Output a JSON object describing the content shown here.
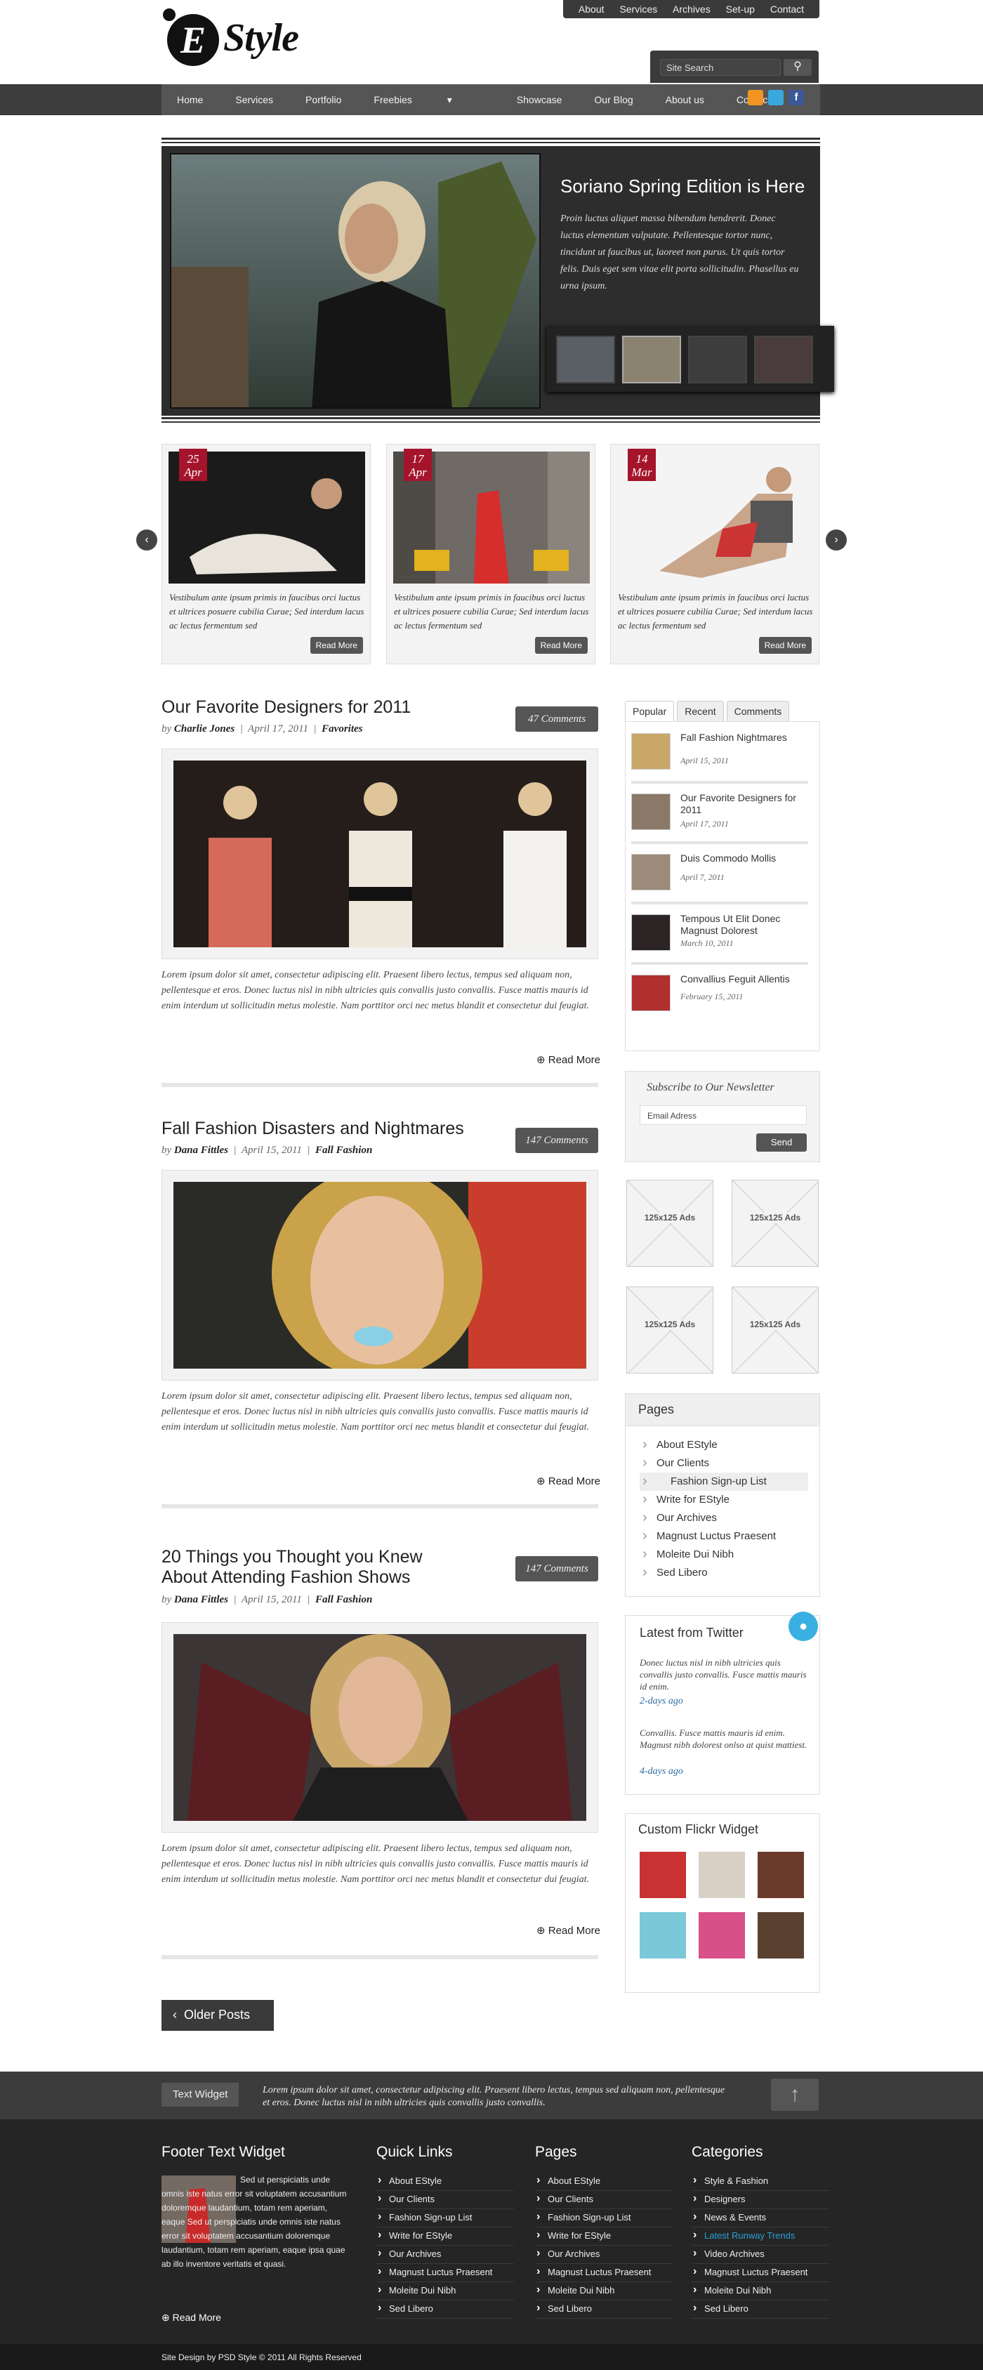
{
  "top_nav": [
    "About",
    "Services",
    "Archives",
    "Set-up",
    "Contact"
  ],
  "logo": {
    "mark": "E",
    "text": "Style"
  },
  "search": {
    "placeholder": "Site Search",
    "icon": "magnifier-icon"
  },
  "main_nav": [
    "Home",
    "Services",
    "Portfolio",
    "Freebies",
    "Showcase",
    "Our Blog",
    "About us",
    "Contact"
  ],
  "social_icons": [
    "rss-icon",
    "twitter-icon",
    "facebook-icon"
  ],
  "colors": {
    "accent_red": "#a4142b",
    "dark": "#2d2d2d",
    "link_blue": "#2a6aa0"
  },
  "slider": {
    "title": "Soriano Spring Edition is Here",
    "text": "Proin luctus aliquet massa bibendum hendrerit. Donec luctus elementum vulputate. Pellentesque tortor nunc, tincidunt ut faucibus ut, laoreet non purus. Ut quis tortor felis. Duis eget sem vitae elit porta sollicitudin. Phasellus eu urna ipsum."
  },
  "carousel": [
    {
      "day": "25",
      "month": "Apr",
      "text": "Vestibulum ante ipsum primis in faucibus orci luctus et ultrices posuere cubilia Curae; Sed interdum lacus ac lectus fermentum sed",
      "button": "Read More"
    },
    {
      "day": "17",
      "month": "Apr",
      "text": "Vestibulum ante ipsum primis in faucibus orci luctus et ultrices posuere cubilia Curae; Sed interdum lacus ac lectus fermentum sed",
      "button": "Read More"
    },
    {
      "day": "14",
      "month": "Mar",
      "text": "Vestibulum ante ipsum primis in faucibus orci luctus et ultrices posuere cubilia Curae; Sed interdum lacus ac lectus fermentum sed",
      "button": "Read More"
    }
  ],
  "posts": [
    {
      "title": "Our Favorite Designers for 2011",
      "by": "by",
      "author": "Charlie Jones",
      "date": "April 17, 2011",
      "category": "Favorites",
      "comments": "47 Comments",
      "excerpt": "Lorem ipsum dolor sit amet, consectetur adipiscing elit. Praesent libero lectus, tempus sed aliquam non, pellentesque et eros. Donec luctus nisl in nibh ultricies quis convallis justo convallis. Fusce mattis mauris id enim interdum ut sollicitudin metus molestie. Nam porttitor orci nec metus blandit et consectetur dui feugiat.",
      "more": "Read More"
    },
    {
      "title": "Fall Fashion Disasters and Nightmares",
      "by": "by",
      "author": "Dana Fittles",
      "date": "April 15, 2011",
      "category": "Fall Fashion",
      "comments": "147 Comments",
      "excerpt": "Lorem ipsum dolor sit amet, consectetur adipiscing elit. Praesent libero lectus, tempus sed aliquam non, pellentesque et eros. Donec luctus nisl in nibh ultricies quis convallis justo convallis. Fusce mattis mauris id enim interdum ut sollicitudin metus molestie. Nam porttitor orci nec metus blandit et consectetur dui feugiat.",
      "more": "Read More"
    },
    {
      "title": "20 Things you Thought you Knew About Attending Fashion Shows",
      "by": "by",
      "author": "Dana Fittles",
      "date": "April 15, 2011",
      "category": "Fall Fashion",
      "comments": "147 Comments",
      "excerpt": "Lorem ipsum dolor sit amet, consectetur adipiscing elit. Praesent libero lectus, tempus sed aliquam non, pellentesque et eros. Donec luctus nisl in nibh ultricies quis convallis justo convallis. Fusce mattis mauris id enim interdum ut sollicitudin metus molestie. Nam porttitor orci nec metus blandit et consectetur dui feugiat.",
      "more": "Read More"
    }
  ],
  "older_posts": "Older Posts",
  "sidebar": {
    "tabs": [
      "Popular",
      "Recent",
      "Comments"
    ],
    "popular": [
      {
        "title": "Fall Fashion Nightmares",
        "date": "April 15, 2011"
      },
      {
        "title": "Our Favorite Designers for 2011",
        "date": "April 17, 2011"
      },
      {
        "title": "Duis Commodo Mollis",
        "date": "April 7, 2011"
      },
      {
        "title": "Tempous Ut Elit Donec Magnust Dolorest",
        "date": "March 10, 2011"
      },
      {
        "title": "Convallius Feguit Allentis",
        "date": "February 15, 2011"
      }
    ],
    "newsletter": {
      "title": "Subscribe to Our Newsletter",
      "placeholder": "Email Adress",
      "button": "Send"
    },
    "ads": [
      "125x125 Ads",
      "125x125 Ads",
      "125x125 Ads",
      "125x125 Ads"
    ],
    "pages": {
      "title": "Pages",
      "items": [
        "About EStyle",
        "Our Clients",
        "Fashion Sign-up List",
        "Write for EStyle",
        "Our Archives",
        "Magnust Luctus Praesent",
        "Moleite Dui Nibh",
        "Sed Libero"
      ]
    },
    "twitter": {
      "title": "Latest from Twitter",
      "tweets": [
        {
          "text": "Donec luctus nisl in nibh ultricies quis convallis justo convallis. Fusce mattis mauris id enim.",
          "time": "2-days ago"
        },
        {
          "text": "Convallis. Fusce mattis mauris id enim. Magnust nibh dolorest onlso at quist mattiest.",
          "time": "4-days ago"
        }
      ]
    },
    "flickr": {
      "title": "Custom Flickr Widget"
    }
  },
  "footer": {
    "text_widget_label": "Text Widget",
    "text_widget_body": "Lorem ipsum dolor sit amet, consectetur adipiscing elit. Praesent libero lectus, tempus sed aliquam non, pellentesque et eros. Donec luctus nisl in nibh ultricies quis convallis justo convallis.",
    "col1": {
      "title": "Footer Text Widget",
      "text": "Sed ut perspiciatis unde omnis iste natus error sit voluptatem accusantium doloremque laudantium, totam rem aperiam, eaque Sed ut perspiciatis unde omnis iste natus error sit voluptatem accusantium doloremque laudantium, totam rem aperiam, eaque ipsa quae ab illo inventore veritatis et quasi.",
      "more": "Read More"
    },
    "col2": {
      "title": "Quick Links",
      "items": [
        "About EStyle",
        "Our Clients",
        "Fashion Sign-up List",
        "Write for EStyle",
        "Our Archives",
        "Magnust Luctus Praesent",
        "Moleite Dui Nibh",
        "Sed Libero"
      ]
    },
    "col3": {
      "title": "Pages",
      "items": [
        "About EStyle",
        "Our Clients",
        "Fashion Sign-up List",
        "Write for EStyle",
        "Our Archives",
        "Magnust Luctus Praesent",
        "Moleite Dui Nibh",
        "Sed Libero"
      ]
    },
    "col4": {
      "title": "Categories",
      "items": [
        "Style & Fashion",
        "Designers",
        "News & Events",
        "Latest Runway Trends",
        "Video Archives",
        "Magnust Luctus Praesent",
        "Moleite Dui Nibh",
        "Sed Libero"
      ]
    },
    "copyright": "Site Design by PSD Style © 2011 All Rights Reserved"
  }
}
